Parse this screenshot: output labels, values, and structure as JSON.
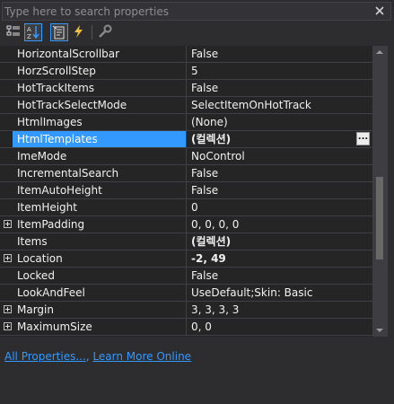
{
  "search": {
    "placeholder": "Type here to search properties",
    "value": ""
  },
  "toolbar": {
    "buttons": [
      {
        "name": "categorized-icon"
      },
      {
        "name": "alphabetical-icon",
        "active": true
      },
      {
        "name": "properties-icon",
        "active": true
      },
      {
        "name": "events-icon"
      },
      {
        "name": "property-pages-icon"
      }
    ]
  },
  "properties": [
    {
      "name": "HorizontalScrollbar",
      "value": "False"
    },
    {
      "name": "HorzScrollStep",
      "value": "5"
    },
    {
      "name": "HotTrackItems",
      "value": "False"
    },
    {
      "name": "HotTrackSelectMode",
      "value": "SelectItemOnHotTrack"
    },
    {
      "name": "HtmlImages",
      "value": "(None)"
    },
    {
      "name": "HtmlTemplates",
      "value": "(컬렉션)",
      "bold": true,
      "selected": true,
      "ellipsis": "..."
    },
    {
      "name": "ImeMode",
      "value": "NoControl"
    },
    {
      "name": "IncrementalSearch",
      "value": "False"
    },
    {
      "name": "ItemAutoHeight",
      "value": "False"
    },
    {
      "name": "ItemHeight",
      "value": "0"
    },
    {
      "name": "ItemPadding",
      "value": "0, 0, 0, 0",
      "expandable": true
    },
    {
      "name": "Items",
      "value": "(컬렉션)",
      "bold": true
    },
    {
      "name": "Location",
      "value": "-2, 49",
      "bold": true,
      "expandable": true
    },
    {
      "name": "Locked",
      "value": "False"
    },
    {
      "name": "LookAndFeel",
      "value": "UseDefault;Skin: Basic"
    },
    {
      "name": "Margin",
      "value": "3, 3, 3, 3",
      "expandable": true
    },
    {
      "name": "MaximumSize",
      "value": "0, 0",
      "expandable": true
    }
  ],
  "links": {
    "all_properties": "All Properties...",
    "separator": ",",
    "learn_more": "Learn More Online"
  },
  "colors": {
    "background": "#2d2d30",
    "grid": "#252526",
    "selection": "#3399ff",
    "link": "#3399ff"
  }
}
